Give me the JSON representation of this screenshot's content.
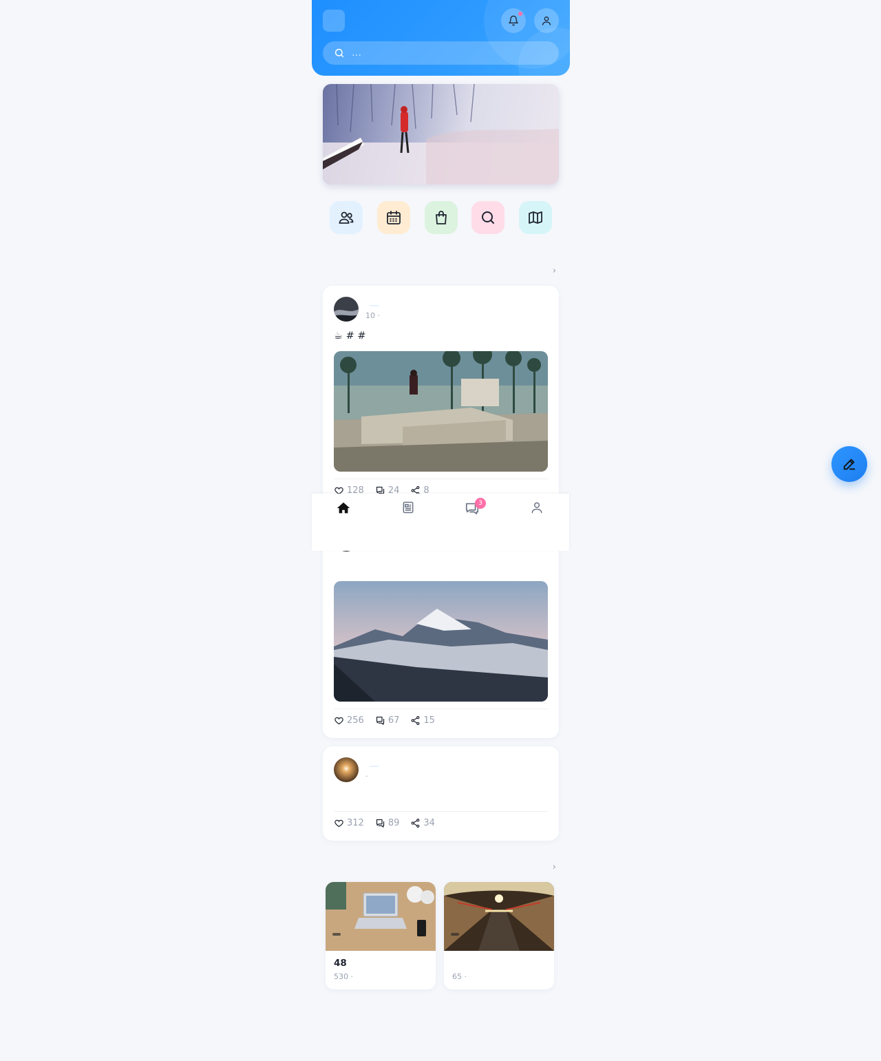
{
  "header": {
    "logo_glyph": "",
    "app_title": "",
    "search_placeholder": "…",
    "notification_icon": "bell-icon",
    "profile_icon": "user-icon",
    "accent_color": "#1e8fff"
  },
  "quick_links": [
    {
      "label": "",
      "icon": "users-icon",
      "bg": "#e3f1ff"
    },
    {
      "label": "",
      "icon": "calendar-icon",
      "bg": "#ffecd2"
    },
    {
      "label": "",
      "icon": "shopping-bag-icon",
      "bg": "#dcf3df"
    },
    {
      "label": "",
      "icon": "search-icon",
      "bg": "#ffdce8"
    },
    {
      "label": "",
      "icon": "map-icon",
      "bg": "#d6f5f8"
    }
  ],
  "feed_section": {
    "title": " ",
    "more": " ›"
  },
  "posts": [
    {
      "user": "",
      "tag": "",
      "meta": "10 · ",
      "text": "☕ # #",
      "likes": "128",
      "comments": "24",
      "shares": "8"
    },
    {
      "text": " ",
      "likes": "256",
      "comments": "67",
      "shares": "15"
    },
    {
      "user": "",
      "tag": "",
      "meta": " · ",
      "text": "",
      "likes": "312",
      "comments": "89",
      "shares": "34"
    }
  ],
  "activity_section": {
    "title": " ",
    "more": " ›"
  },
  "activities": [
    {
      "badge": " ",
      "title": "48",
      "meta": "530 · "
    },
    {
      "badge": " ",
      "title": "",
      "meta": "65 · "
    }
  ],
  "bottom_nav": [
    {
      "label": "",
      "icon": "home-icon",
      "active": true
    },
    {
      "label": "",
      "icon": "news-icon"
    },
    {
      "label": "",
      "icon": "chat-icon",
      "badge": "3"
    },
    {
      "label": "",
      "icon": "user-icon"
    }
  ],
  "fab": {
    "icon": "edit-icon"
  }
}
